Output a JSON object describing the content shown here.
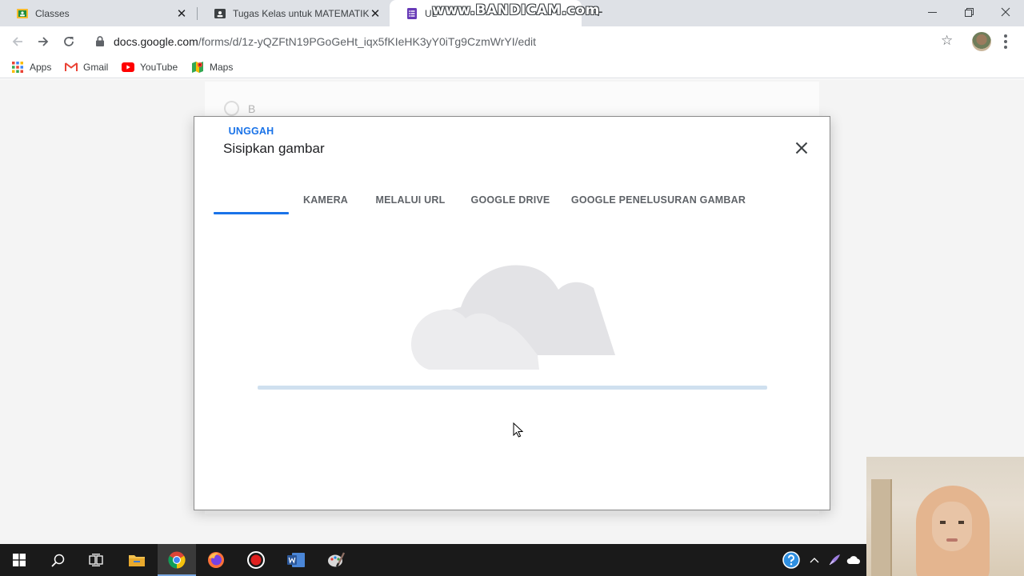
{
  "browser": {
    "tabs": [
      {
        "title": "Classes",
        "icon": "google-classroom-icon"
      },
      {
        "title": "Tugas Kelas untuk MATEMATIKA",
        "icon": "classroom-assignment-icon"
      },
      {
        "title": "UL",
        "icon": "google-forms-icon"
      }
    ],
    "watermark": "www.BANDICAM.com",
    "url_host": "docs.google.com",
    "url_path": "/forms/d/1z-yQZFtN19PGoGeHt_iqx5fKIeHK3yY0iTg9CzmWrYI/edit",
    "bookmarks": [
      {
        "label": "Apps",
        "icon": "apps-grid-icon"
      },
      {
        "label": "Gmail",
        "icon": "gmail-icon"
      },
      {
        "label": "YouTube",
        "icon": "youtube-icon"
      },
      {
        "label": "Maps",
        "icon": "maps-icon"
      }
    ]
  },
  "form": {
    "option_label": "B"
  },
  "dialog": {
    "title": "Sisipkan gambar",
    "tabs": [
      {
        "label": "UNGGAH"
      },
      {
        "label": "KAMERA"
      },
      {
        "label": "MELALUI URL"
      },
      {
        "label": "GOOGLE DRIVE"
      },
      {
        "label": "GOOGLE PENELUSURAN GAMBAR"
      }
    ],
    "active_tab": "UNGGAH"
  },
  "taskbar": {
    "apps": [
      "windows-start-icon",
      "search-icon",
      "task-view-icon",
      "file-explorer-icon",
      "chrome-icon",
      "firefox-icon",
      "bandicam-record-icon",
      "word-icon",
      "paint-icon"
    ]
  },
  "colors": {
    "accent": "#1a73e8",
    "progress": "#cfe0ef",
    "cloud": "#e3e3e6"
  }
}
